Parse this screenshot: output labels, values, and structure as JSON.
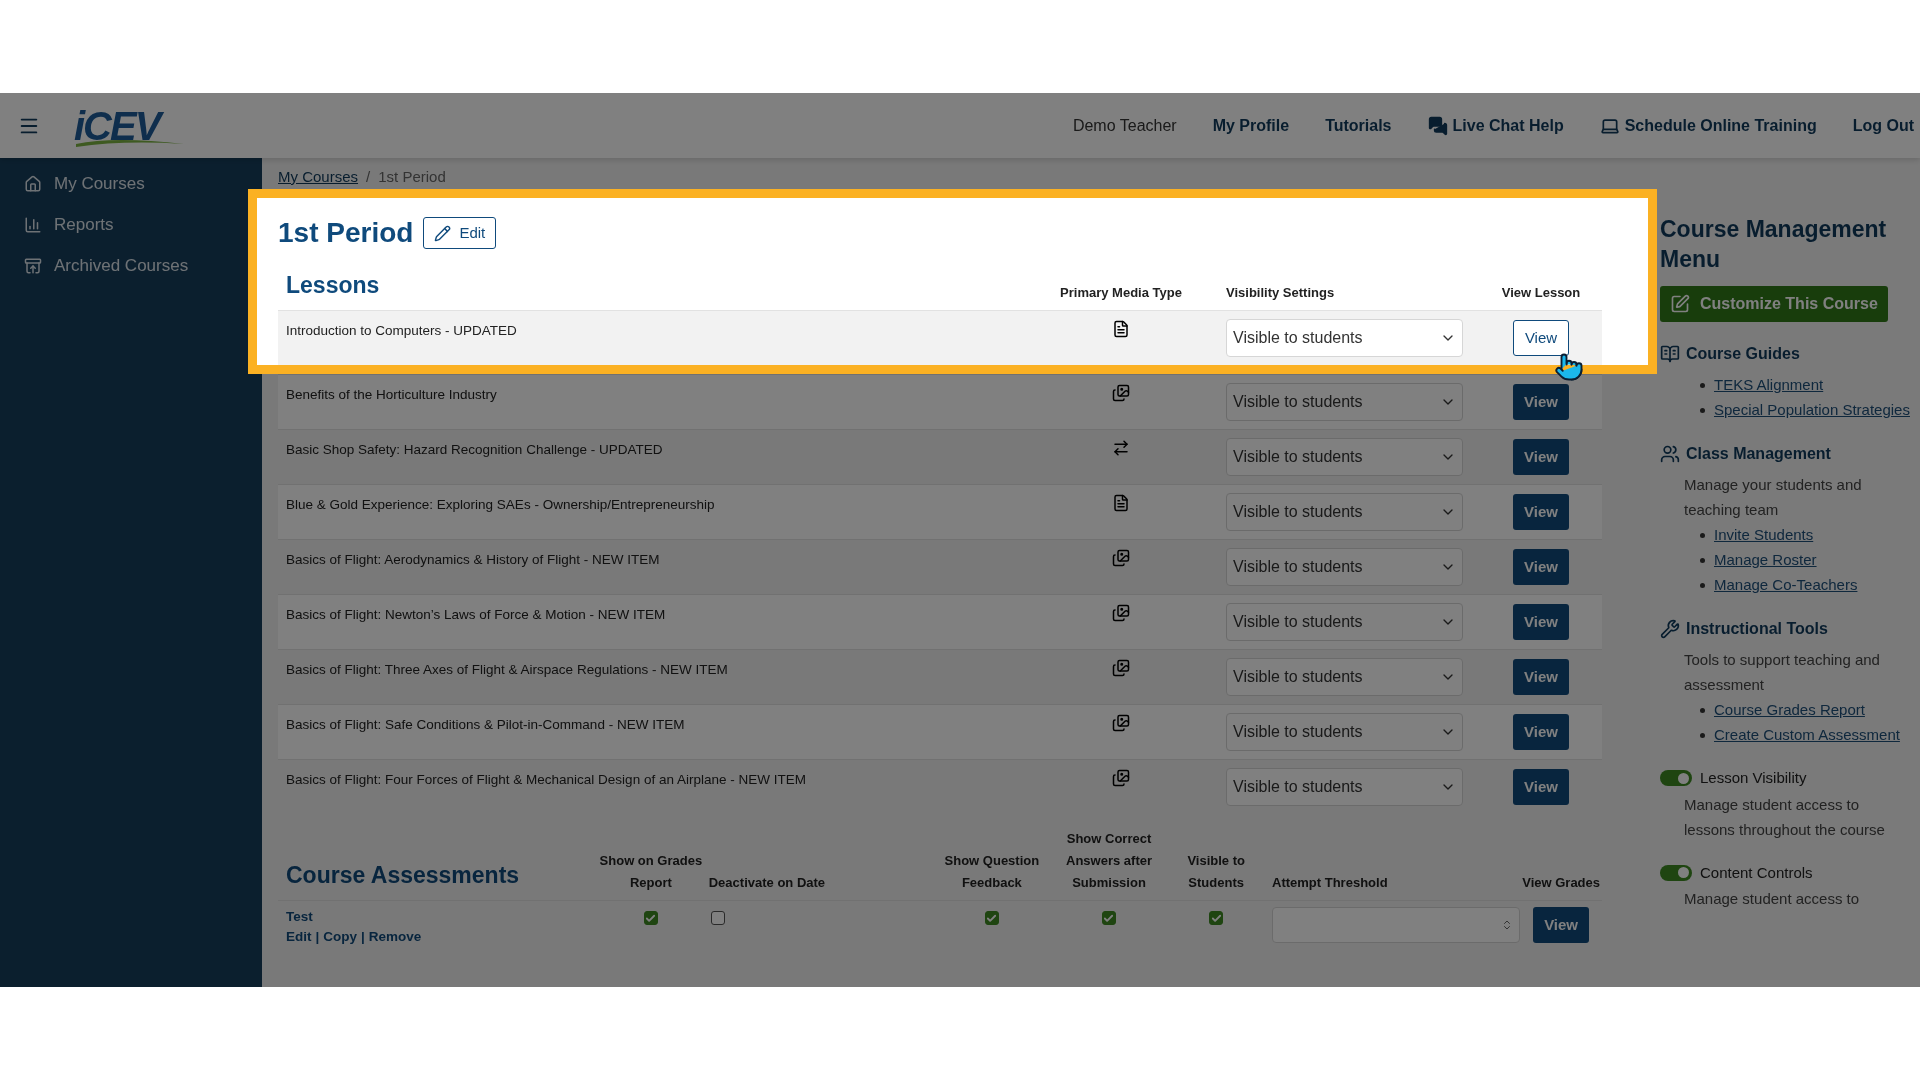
{
  "header": {
    "logo": "iCEV",
    "nav": [
      {
        "kind": "plain",
        "label": "Demo Teacher"
      },
      {
        "kind": "link",
        "label": "My Profile"
      },
      {
        "kind": "link",
        "label": "Tutorials"
      },
      {
        "kind": "chat",
        "label": "Live Chat Help"
      },
      {
        "kind": "screen",
        "label": "Schedule Online Training"
      },
      {
        "kind": "link",
        "label": "Log Out"
      }
    ]
  },
  "sidebar": {
    "items": [
      {
        "kind": "home",
        "label": "My Courses"
      },
      {
        "kind": "reports",
        "label": "Reports"
      },
      {
        "kind": "archive",
        "label": "Archived Courses"
      }
    ]
  },
  "breadcrumb": {
    "items": [
      "My Courses",
      "1st Period"
    ],
    "separator": "/"
  },
  "course": {
    "title": "1st Period",
    "edit_button": "Edit"
  },
  "lessons": {
    "heading": "Lessons",
    "columns": [
      "Primary Media Type",
      "Visibility Settings",
      "View Lesson"
    ],
    "rows": [
      {
        "title": "Introduction to Computers - UPDATED",
        "kind": "document",
        "visibility": "Visible to students",
        "button": "View",
        "hovered": true
      },
      {
        "title": "Benefits of the Horticulture Industry",
        "kind": "gallery",
        "visibility": "Visible to students",
        "button": "View",
        "hovered": false
      },
      {
        "title": "Basic Shop Safety: Hazard Recognition Challenge - UPDATED",
        "kind": "swap",
        "visibility": "Visible to students",
        "button": "View",
        "hovered": false
      },
      {
        "title": "Blue & Gold Experience: Exploring SAEs - Ownership/Entrepreneurship",
        "kind": "document",
        "visibility": "Visible to students",
        "button": "View",
        "hovered": false
      },
      {
        "title": "Basics of Flight: Aerodynamics & History of Flight - NEW ITEM",
        "kind": "gallery",
        "visibility": "Visible to students",
        "button": "View",
        "hovered": false
      },
      {
        "title": "Basics of Flight: Newton’s Laws of Force & Motion - NEW ITEM",
        "kind": "gallery",
        "visibility": "Visible to students",
        "button": "View",
        "hovered": false
      },
      {
        "title": "Basics of Flight: Three Axes of Flight & Airspace Regulations - NEW ITEM",
        "kind": "gallery",
        "visibility": "Visible to students",
        "button": "View",
        "hovered": false
      },
      {
        "title": "Basics of Flight: Safe Conditions & Pilot-in-Command - NEW ITEM",
        "kind": "gallery",
        "visibility": "Visible to students",
        "button": "View",
        "hovered": false
      },
      {
        "title": "Basics of Flight: Four Forces of Flight & Mechanical Design of an Airplane - NEW ITEM",
        "kind": "gallery",
        "visibility": "Visible to students",
        "button": "View",
        "hovered": false
      }
    ]
  },
  "assessments": {
    "heading": "Course Assessments",
    "columns": [
      "Show on Grades Report",
      "Deactivate on Date",
      "Show Question Feedback",
      "Show Correct Answers after Submission",
      "Visible to Students",
      "Attempt Threshold",
      "View Grades"
    ],
    "rows": [
      {
        "name": "Test",
        "actions": [
          "Edit",
          "Copy",
          "Remove"
        ],
        "separator": "|",
        "show_on_grades": true,
        "deactivate": false,
        "feedback": true,
        "correct_answers": true,
        "visible": true,
        "button": "View"
      }
    ]
  },
  "menu": {
    "heading": "Course Management Menu",
    "customize_button": "Customize This Course",
    "sections": [
      {
        "kind": "guides",
        "title": "Course Guides",
        "links": [
          "TEKS Alignment",
          "Special Population Strategies"
        ]
      },
      {
        "kind": "class",
        "title": "Class Management",
        "description": "Manage your students and teaching team",
        "links": [
          "Invite Students",
          "Manage Roster",
          "Manage Co-Teachers"
        ]
      },
      {
        "kind": "tools",
        "title": "Instructional Tools",
        "description": "Tools to support teaching and assessment",
        "links": [
          "Course Grades Report",
          "Create Custom Assessment"
        ]
      }
    ],
    "toggles": [
      {
        "label": "Lesson Visibility",
        "on": true,
        "description": "Manage student access to lessons throughout the course"
      },
      {
        "label": "Content Controls",
        "on": true,
        "description": "Manage student access to"
      }
    ]
  }
}
